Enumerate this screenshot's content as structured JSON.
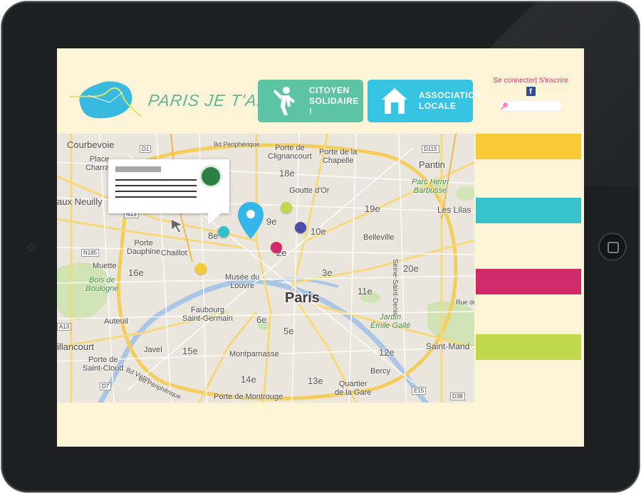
{
  "header": {
    "logo_text": "PARIS JE T'AIDE!",
    "buttons": [
      {
        "label": "CITOYEN\nSOLIDAIRE !",
        "icon": "person-waving-icon",
        "color": "#5cc3a3"
      },
      {
        "label": "ASSOCIATION\nLOCALE",
        "icon": "house-icon",
        "color": "#36c4e2"
      }
    ],
    "auth": {
      "login": "Se connecter",
      "separator": "|",
      "signup": "S'inscrire"
    },
    "search": {
      "placeholder": ""
    }
  },
  "map": {
    "labels": {
      "courbevoie": "Courbevoie",
      "place_charras": "Place\nCharras",
      "neuilly": "aux Neuilly",
      "bd_peripherique_top": "Bd Périphérique",
      "porte_clignancourt": "Porte de\nClignancourt",
      "porte_chapelle": "Porte de la\nChapelle",
      "pantin": "Pantin",
      "parc_henri_barbusse": "Parc Henri\nBarbusse",
      "les_lilas": "Les Lilas",
      "goutte_dor": "Goutte d'Or",
      "belleville": "Belleville",
      "seine_saint_denis": "Seine-Saint-Denis",
      "porte_dauphine": "Porte\nDauphine",
      "chaillot": "Chaillot",
      "muette": "Muette",
      "bois_boulogne": "Bois de\nBoulogne",
      "musee_louvre": "Musée du\nLouvre",
      "paris": "Paris",
      "faubourg_st_germain": "Faubourg\nSaint-Germain",
      "jardin_emile_galle": "Jardin\nÉmile Gallé",
      "auteuil": "Auteuil",
      "javel": "Javel",
      "montparnasse": "Montparnasse",
      "saint_mande": "Saint-Mand",
      "billancourt": "illancourt",
      "porte_saint_cloud": "Porte de\nSaint-Cloud",
      "bd_victor": "Bd Victor",
      "bd_peripherique_bottom": "Bd Périphérique",
      "bercy": "Bercy",
      "quartier_gare": "Quartier\nde la Gare",
      "porte_montrouge": "Porte de Montrouge",
      "rue_de": "Rue de",
      "arr_18": "18e",
      "arr_19": "19e",
      "arr_9": "9e",
      "arr_10": "10e",
      "arr_8": "8e",
      "arr_2": "2e",
      "arr_3": "3e",
      "arr_16": "16e",
      "arr_11": "11e",
      "arr_20": "20e",
      "arr_6": "6e",
      "arr_5": "5e",
      "arr_15": "15e",
      "arr_12": "12e",
      "arr_14": "14e",
      "arr_13": "13e",
      "road_d1": "D1",
      "road_d115": "D115",
      "road_n13": "N13",
      "road_n185": "N185",
      "road_a13": "A13",
      "road_d7": "D7",
      "road_e15": "E15",
      "road_d38": "D38"
    },
    "markers": [
      {
        "name": "marker-teal",
        "color": "#35c0c9"
      },
      {
        "name": "marker-green",
        "color": "#bfd94a"
      },
      {
        "name": "marker-purple",
        "color": "#4b4ba8"
      },
      {
        "name": "marker-magenta",
        "color": "#d12a6a"
      },
      {
        "name": "marker-yellow",
        "color": "#f7c936"
      }
    ],
    "pin_color": "#36b6e6"
  },
  "stripes": [
    {
      "name": "stripe-yellow",
      "color": "#f7c936"
    },
    {
      "name": "stripe-teal",
      "color": "#37c2c9"
    },
    {
      "name": "stripe-magenta",
      "color": "#d12a6a"
    },
    {
      "name": "stripe-green",
      "color": "#bfd94a"
    }
  ]
}
